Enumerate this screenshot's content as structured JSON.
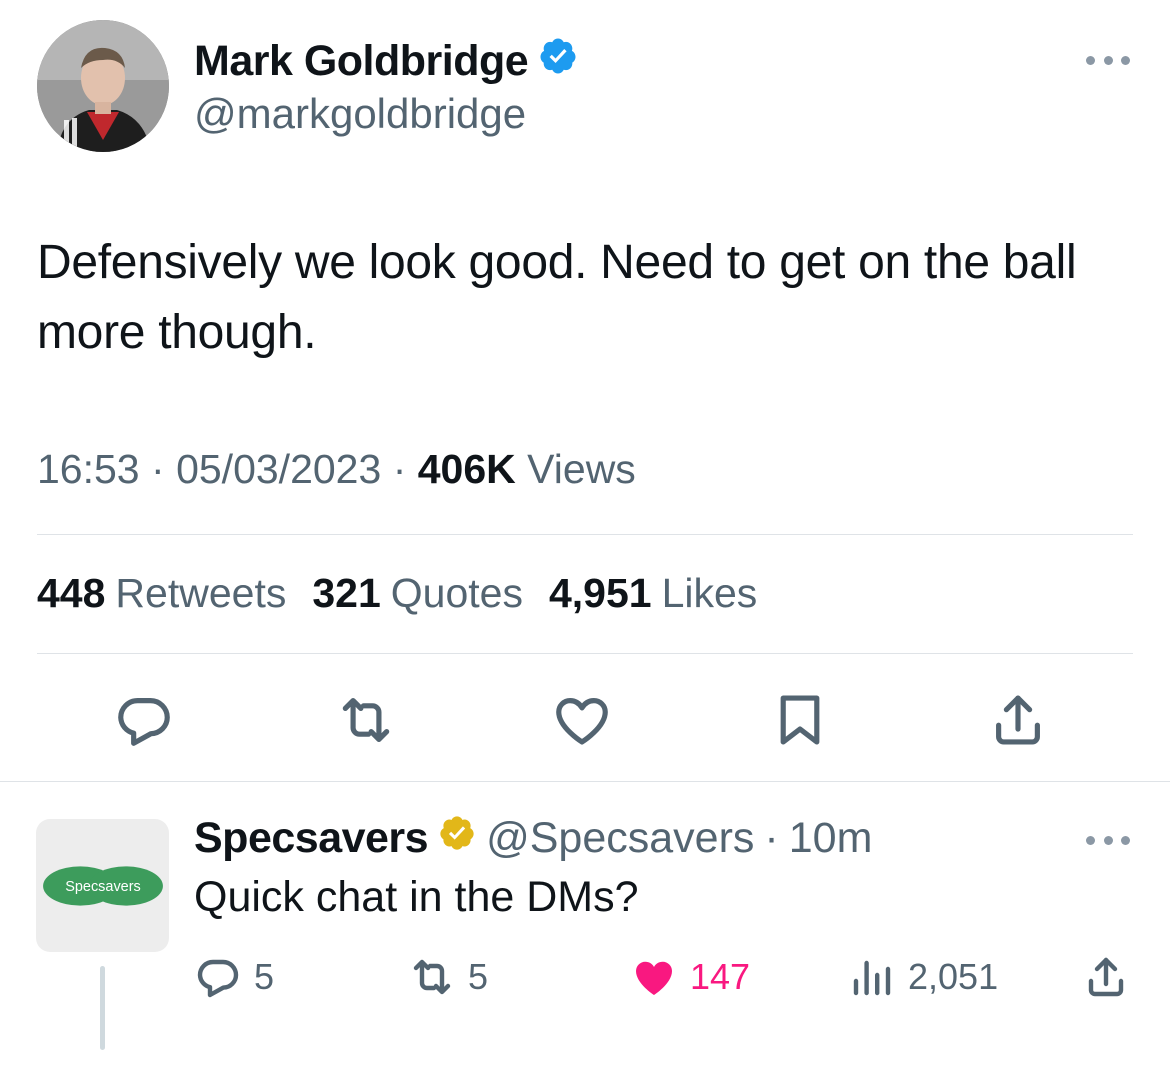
{
  "tweet": {
    "author_name": "Mark Goldbridge",
    "author_handle": "@markgoldbridge",
    "text": "Defensively we look good. Need to get on the ball more though.",
    "time": "16:53",
    "separator": "·",
    "date": "05/03/2023",
    "views_count": "406K",
    "views_label": "Views",
    "stats": {
      "retweets_count": "448",
      "retweets_label": "Retweets",
      "quotes_count": "321",
      "quotes_label": "Quotes",
      "likes_count": "4,951",
      "likes_label": "Likes"
    },
    "verified_color": "#1d9bf0"
  },
  "actions": [
    "reply-icon",
    "retweet-icon",
    "like-icon",
    "bookmark-icon",
    "share-icon"
  ],
  "reply": {
    "author_name": "Specsavers",
    "author_handle": "@Specsavers",
    "separator": "·",
    "time": "10m",
    "text": "Quick chat in the DMs?",
    "logo_text": "Specsavers",
    "verified_color": "#e2b719",
    "logo_color": "#3d9c5c",
    "reply_count": "5",
    "retweet_count": "5",
    "like_count": "147",
    "view_count": "2,051",
    "liked": true,
    "like_color": "#f91880"
  }
}
